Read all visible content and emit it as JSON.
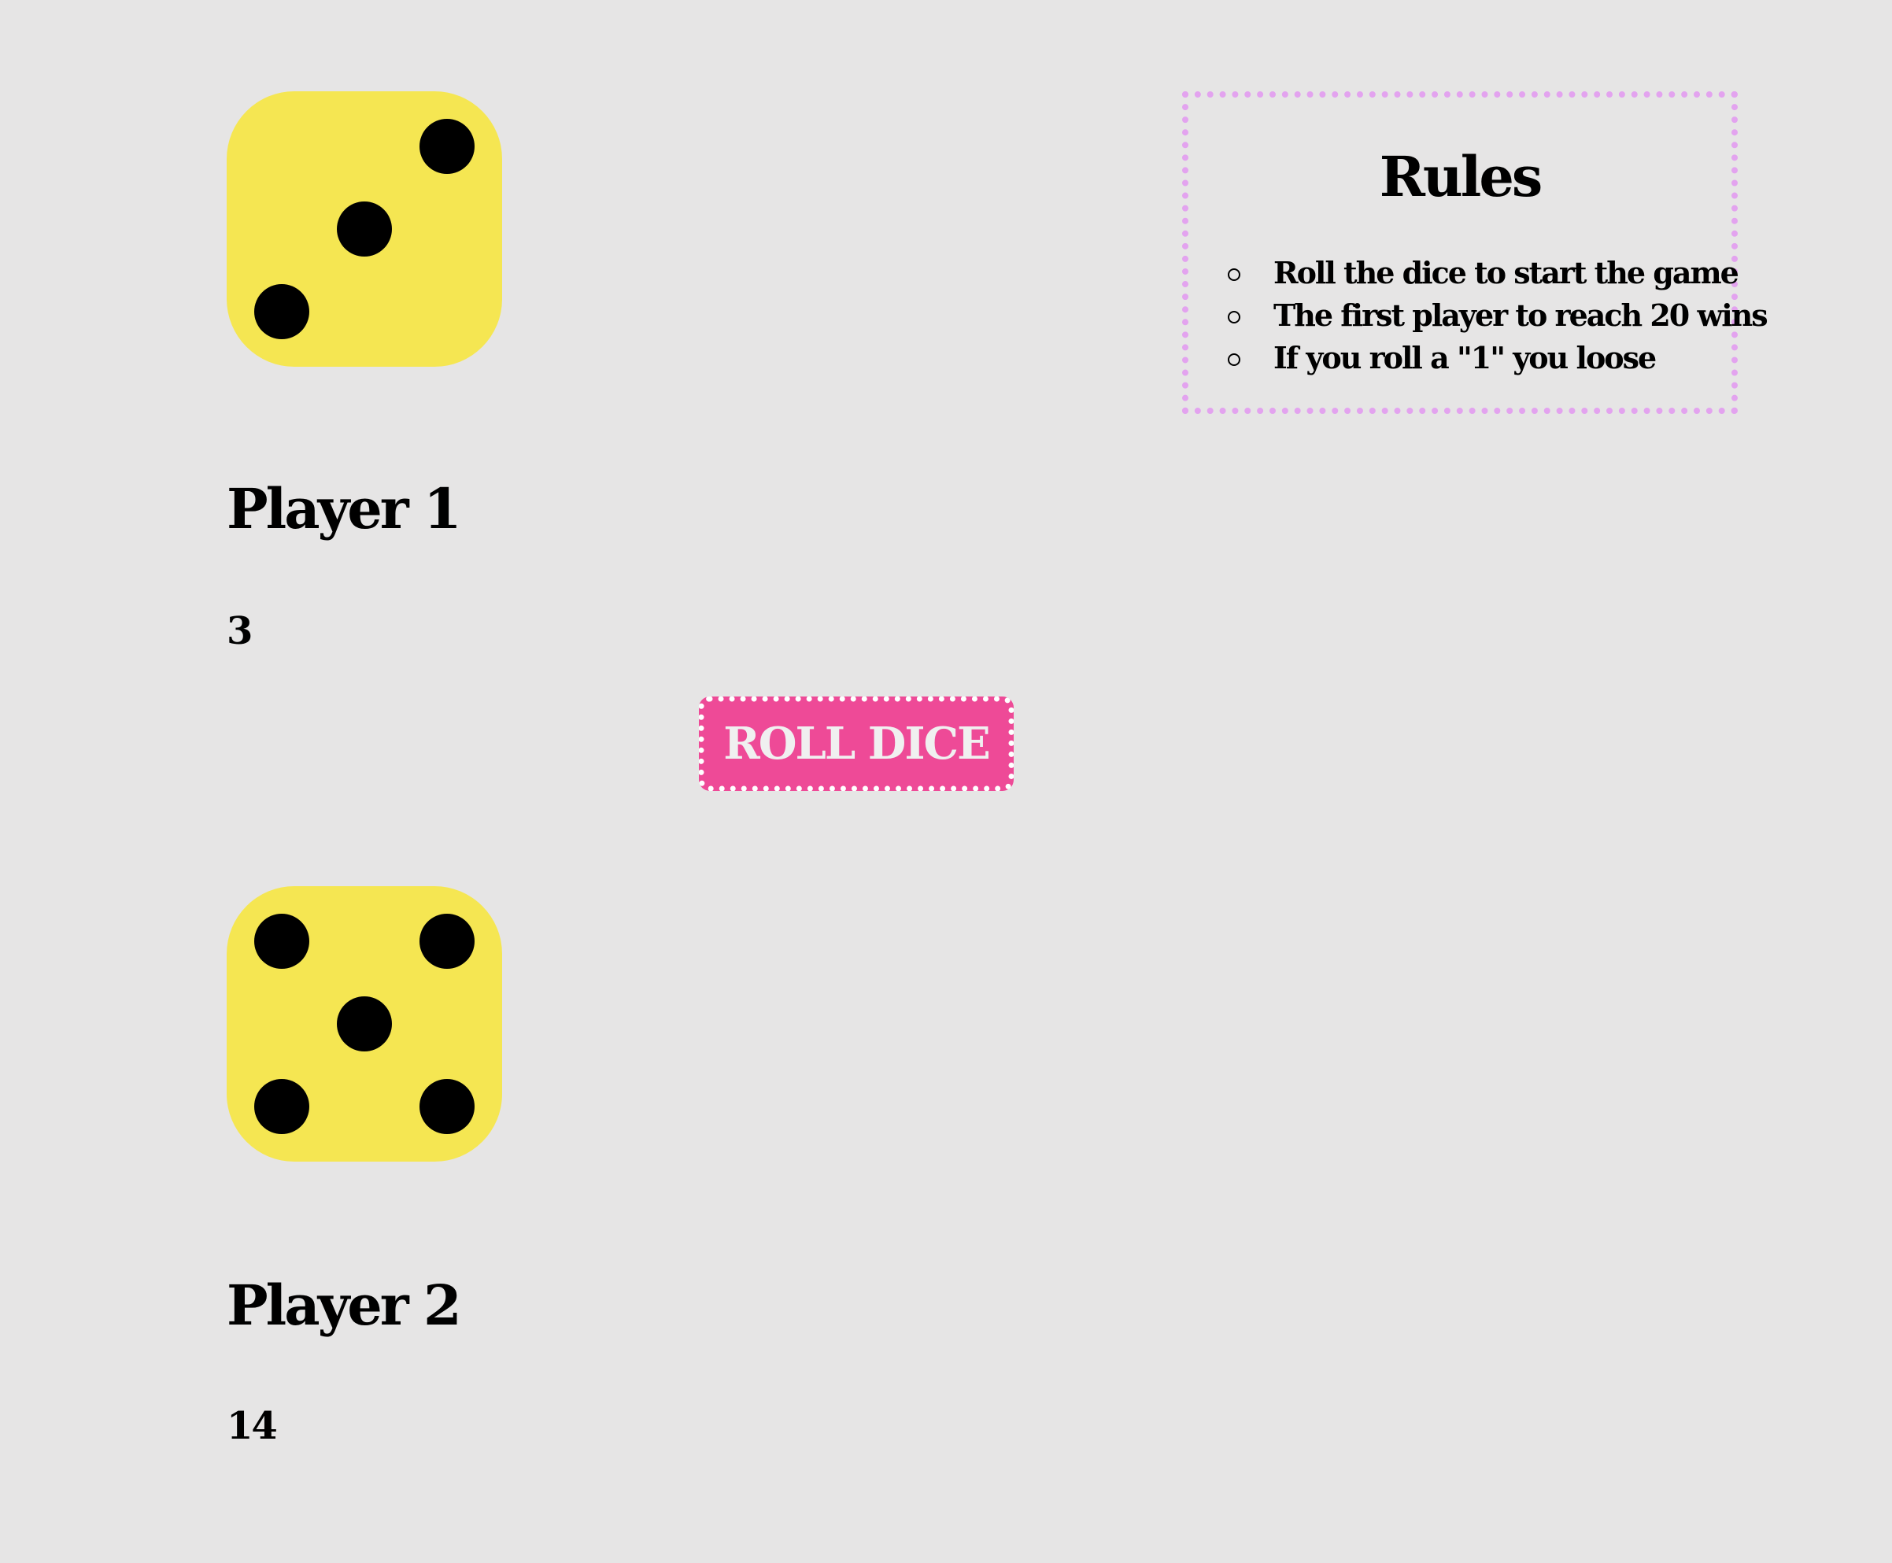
{
  "rules": {
    "title": "Rules",
    "items": [
      "Roll the dice to start the game",
      "The first player to reach 20 wins",
      "If you roll a \"1\" you loose"
    ]
  },
  "players": [
    {
      "name": "Player 1",
      "score": "3",
      "die_value": 3
    },
    {
      "name": "Player 2",
      "score": "14",
      "die_value": 5
    }
  ],
  "roll_button": {
    "label": "ROLL DICE"
  },
  "colors": {
    "background": "#e6e5e5",
    "die": "#f5e652",
    "pip": "#000000",
    "button": "#ee4a97",
    "rules_border": "#e3a3ef"
  }
}
